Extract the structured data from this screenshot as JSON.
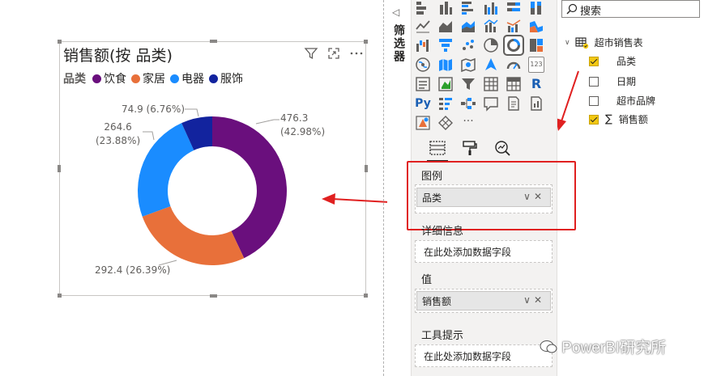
{
  "visual": {
    "title": "销售额(按 品类)",
    "legend_title": "品类",
    "legend": [
      {
        "label": "饮食",
        "color": "#6a0f7d"
      },
      {
        "label": "家居",
        "color": "#e8703a"
      },
      {
        "label": "电器",
        "color": "#1a8cff"
      },
      {
        "label": "服饰",
        "color": "#12239e"
      }
    ],
    "data_labels": {
      "food_value": "476.3",
      "food_pct": "(42.98%)",
      "home_label": "292.4 (26.39%)",
      "elec_value": "264.6",
      "elec_pct": "(23.88%)",
      "cloth_label": "74.9 (6.76%)"
    },
    "icons": [
      "filter-icon",
      "focus-mode-icon",
      "more-options-icon"
    ]
  },
  "chart_data": {
    "type": "pie",
    "donut": true,
    "title": "销售额(按 品类)",
    "legend_title": "品类",
    "categories": [
      "饮食",
      "家居",
      "电器",
      "服饰"
    ],
    "values": [
      476.3,
      292.4,
      264.6,
      74.9
    ],
    "percentages": [
      42.98,
      26.39,
      23.88,
      6.76
    ],
    "colors": [
      "#6a0f7d",
      "#e8703a",
      "#1a8cff",
      "#12239e"
    ],
    "legend_position": "top-left"
  },
  "filter_pane": {
    "label": "筛选器",
    "collapse_glyph": "◁"
  },
  "viz_pane": {
    "more_glyph": "···",
    "python_label": "Py",
    "r_label": "R",
    "kpi_label": "123",
    "wells": {
      "legend_title": "图例",
      "legend_field": "品类",
      "details_title": "详细信息",
      "details_placeholder": "在此处添加数据字段",
      "values_title": "值",
      "values_field": "销售额",
      "tooltip_title": "工具提示",
      "tooltip_placeholder": "在此处添加数据字段"
    },
    "field_controls": "∨✕"
  },
  "fields_pane": {
    "search_placeholder": "搜索",
    "table_name": "超市销售表",
    "fields": [
      {
        "name": "品类",
        "checked": true
      },
      {
        "name": "日期",
        "checked": false
      },
      {
        "name": "超市品牌",
        "checked": false
      },
      {
        "name": "销售额",
        "checked": true,
        "sigma": "∑"
      }
    ]
  },
  "watermark": "PowerBI研究所"
}
